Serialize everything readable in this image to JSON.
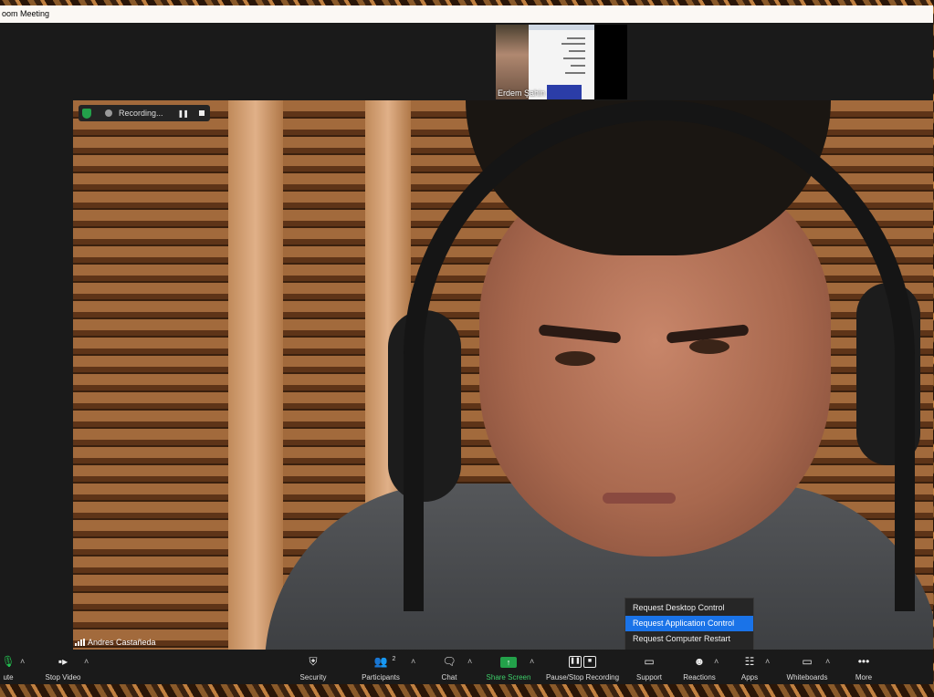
{
  "window": {
    "title": "oom Meeting"
  },
  "thumbnail": {
    "name": "Erdem Şahin"
  },
  "recording": {
    "label": "Recording..."
  },
  "speaker": {
    "name": "Andres Castañeda"
  },
  "menu": {
    "items": [
      {
        "label": "Request Desktop Control"
      },
      {
        "label": "Request Application Control"
      },
      {
        "label": "Request Computer Restart"
      }
    ]
  },
  "toolbar": {
    "mute_label": "ute",
    "stop_video_label": "Stop Video",
    "security_label": "Security",
    "participants_label": "Participants",
    "participants_count": "2",
    "chat_label": "Chat",
    "share_label": "Share Screen",
    "pause_stop_label": "Pause/Stop Recording",
    "support_label": "Support",
    "reactions_label": "Reactions",
    "apps_label": "Apps",
    "whiteboards_label": "Whiteboards",
    "more_label": "More"
  },
  "colors": {
    "accent": "#1a73e8",
    "share_green": "#23a14a",
    "background": "#1a1a1a"
  }
}
